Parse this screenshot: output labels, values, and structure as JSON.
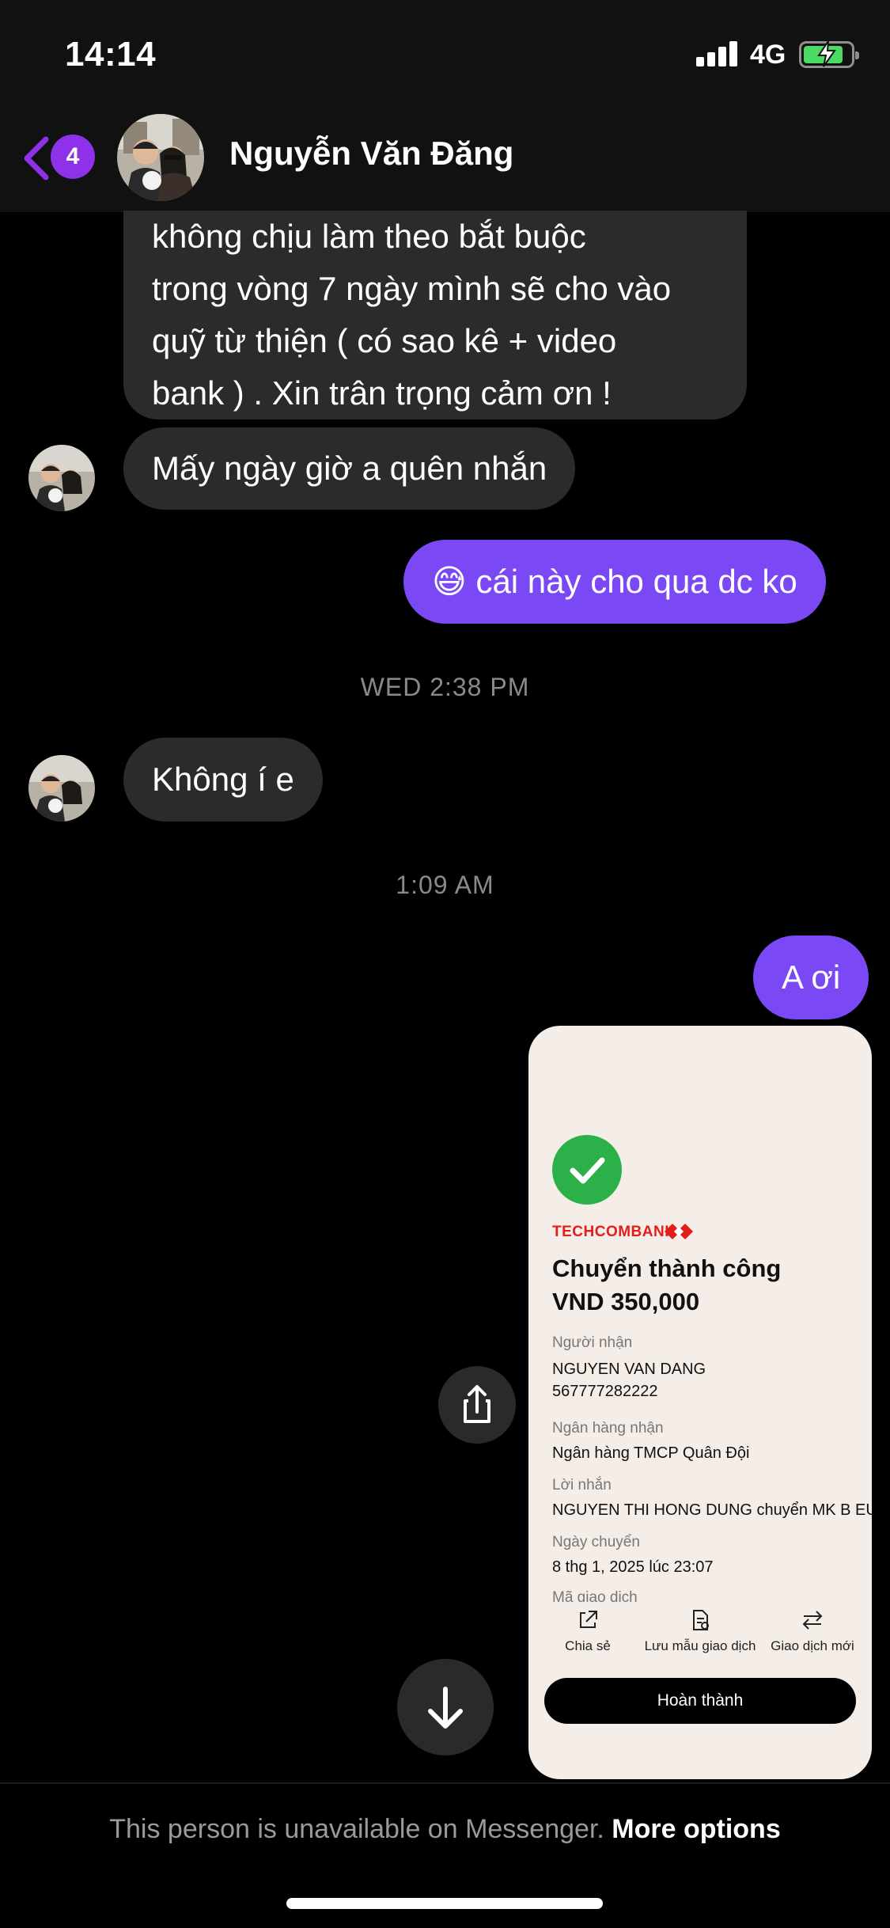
{
  "status_bar": {
    "time": "14:14",
    "network": "4G",
    "battery_state": "charging",
    "battery_color": "#4cd964"
  },
  "header": {
    "back_icon": "chevron-left-icon",
    "unread_count": "4",
    "contact_name": "Nguyễn Văn Đăng",
    "accent_color": "#8e32e9"
  },
  "messages": {
    "long_incoming": {
      "lines": [
        "không chịu làm theo bắt buộc",
        "trong vòng 7 ngày mình sẽ cho vào",
        "quỹ từ thiện ( có sao kê + video",
        "bank ) . Xin trân trọng cảm ơn !"
      ]
    },
    "incoming_1": "Mấy ngày giờ a quên nhắn",
    "outgoing_1": "😅 cái này cho qua dc ko",
    "timestamp_1": "WED 2:38 PM",
    "incoming_2": "Không í e",
    "timestamp_2": "1:09 AM",
    "outgoing_2": "A ơi",
    "outgoing_color": "#7a48f5",
    "incoming_color": "#2b2b2b"
  },
  "shared_image": {
    "brand": "TECHCOMBANK",
    "brand_color": "#e31d1a",
    "title_line1": "Chuyển thành công",
    "title_line2": "VND 350,000",
    "recipient_label": "Người nhận",
    "recipient_name": "NGUYEN VAN DANG",
    "recipient_account": "567777282222",
    "bank_label": "Ngân hàng nhận",
    "bank_value": "Ngân hàng TMCP Quân Đội",
    "message_label": "Lời nhắn",
    "message_value": "NGUYEN THI HONG DUNG chuyển MK B EU",
    "date_label": "Ngày chuyển",
    "date_value": "8 thg 1, 2025 lúc 23:07",
    "txn_label": "Mã giao dịch",
    "actions": [
      "Chia sẻ",
      "Lưu mẫu giao dịch",
      "Giao dịch mới"
    ],
    "done_button": "Hoàn thành"
  },
  "footer": {
    "unavailable_text": "This person is unavailable on Messenger.",
    "more_options": "More options"
  }
}
